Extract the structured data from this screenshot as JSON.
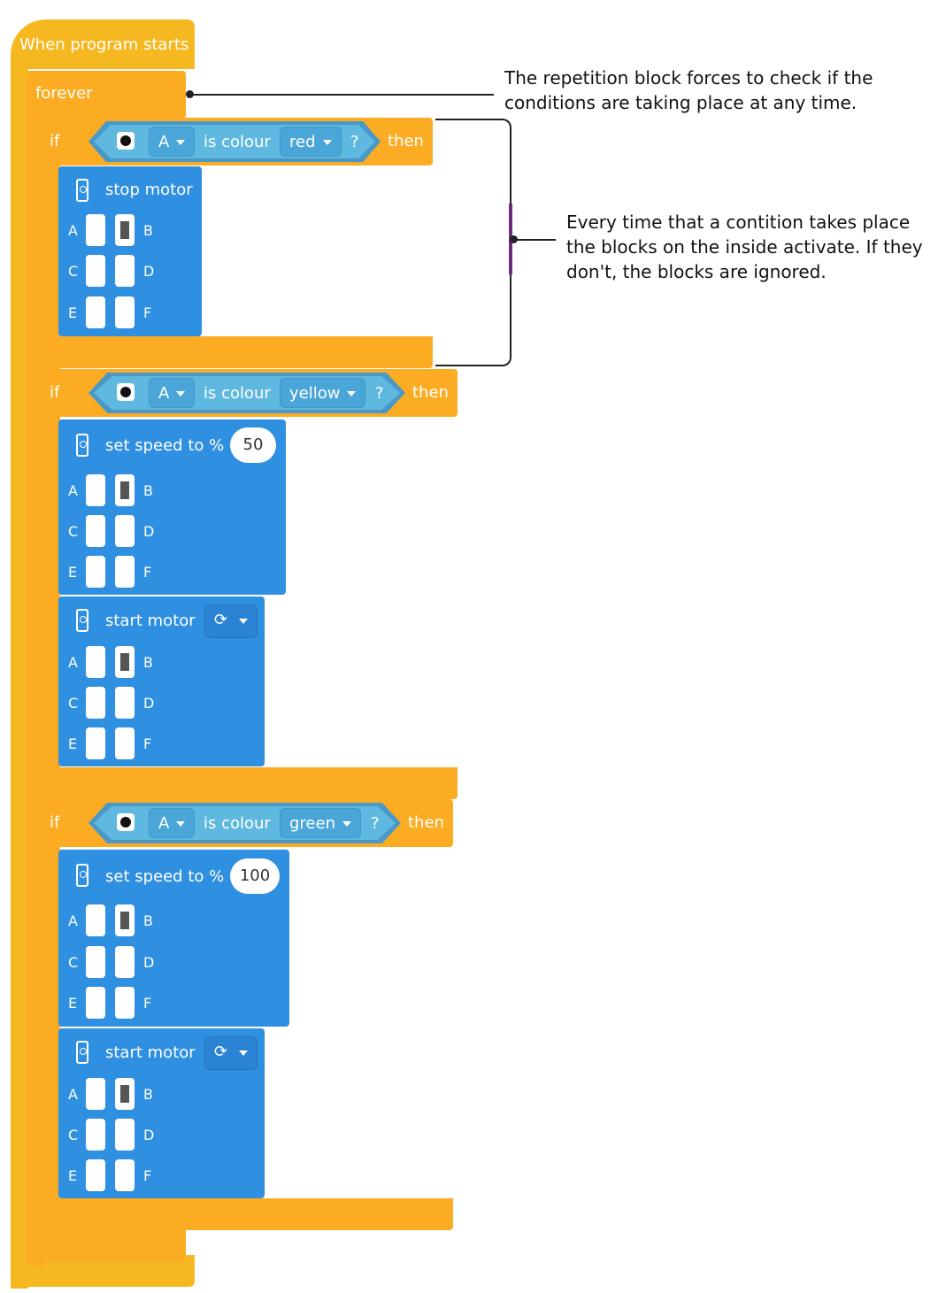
{
  "hat": {
    "label": "When program starts"
  },
  "forever": {
    "label": "forever"
  },
  "ifs": [
    {
      "if": "if",
      "port": "A",
      "is_colour": "is colour",
      "colour": "red",
      "q": "?",
      "then": "then"
    },
    {
      "if": "if",
      "port": "A",
      "is_colour": "is colour",
      "colour": "yellow",
      "q": "?",
      "then": "then"
    },
    {
      "if": "if",
      "port": "A",
      "is_colour": "is colour",
      "colour": "green",
      "q": "?",
      "then": "then"
    }
  ],
  "blocks": {
    "stop": {
      "label": "stop motor"
    },
    "speed1": {
      "label": "set speed to %",
      "value": "50"
    },
    "start1": {
      "label": "start motor",
      "direction_icon": "rotate-clockwise-icon"
    },
    "speed2": {
      "label": "set speed to %",
      "value": "100"
    },
    "start2": {
      "label": "start motor",
      "direction_icon": "rotate-clockwise-icon"
    }
  },
  "ports": {
    "a": "A",
    "b": "B",
    "c": "C",
    "d": "D",
    "e": "E",
    "f": "F"
  },
  "annotations": {
    "forever": "The repetition block forces to check  if the conditions are taking place at any time.",
    "if": "Every time that a contition takes place the blocks on the inside activate. If they don't, the blocks are ignored."
  },
  "colors": {
    "hat": "#f5b820",
    "control": "#fbac23",
    "motor": "#2f8fe0",
    "sensor": "#5fb8df"
  }
}
